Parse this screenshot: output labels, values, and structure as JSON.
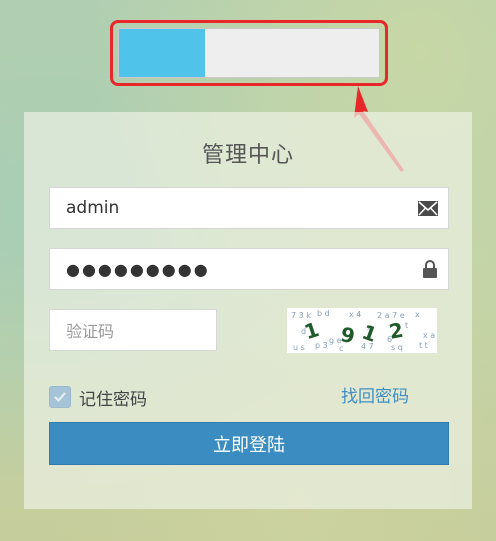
{
  "logo": {
    "fill_fraction": 0.33,
    "fill_color": "#4fc3ea",
    "highlight_color": "#e8272b"
  },
  "panel": {
    "title": "管理中心"
  },
  "form": {
    "username_value": "admin",
    "password_mask": "●●●●●●●●●",
    "captcha_placeholder": "验证码",
    "captcha_image_text": "1912",
    "remember_label": "记住密码",
    "remember_checked": true,
    "forgot_label": "找回密码",
    "login_label": "立即登陆"
  },
  "icons": {
    "username": "envelope-icon",
    "password": "lock-icon"
  },
  "colors": {
    "button": "#3b8dc1",
    "link": "#3f8ec4"
  }
}
